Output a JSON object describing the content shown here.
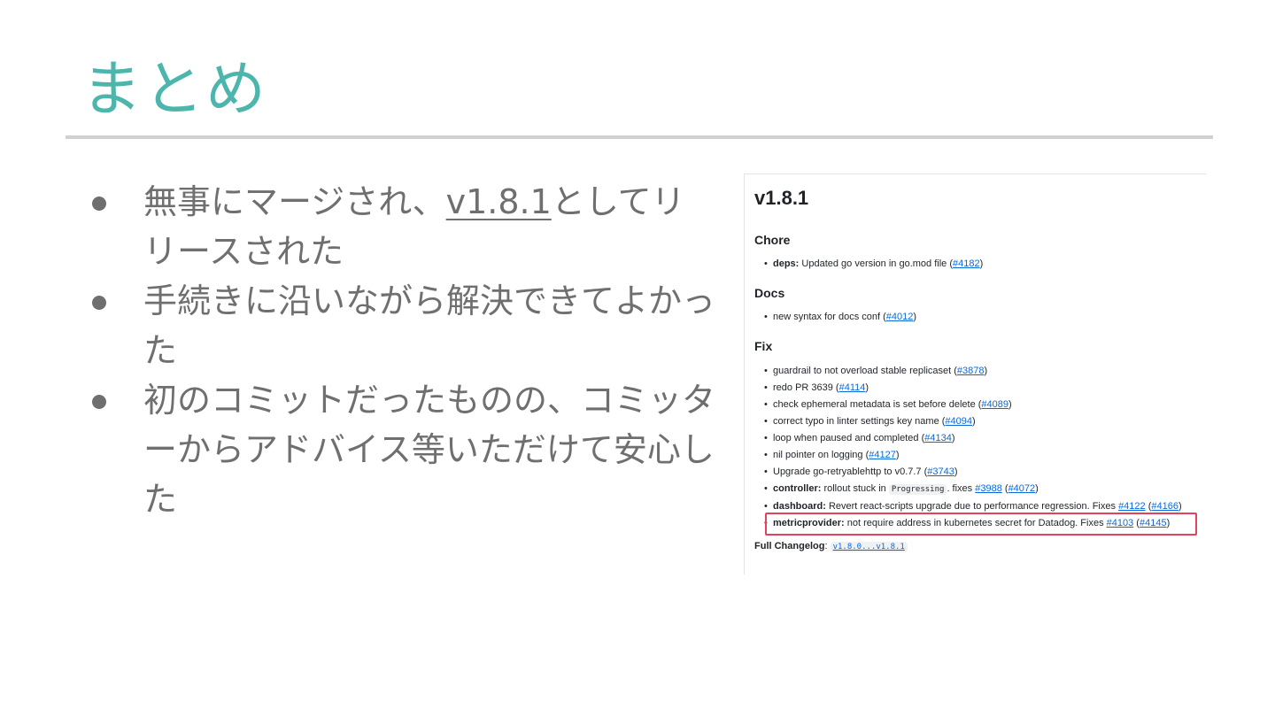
{
  "slide": {
    "title": "まとめ",
    "bullets": [
      {
        "pre": "無事にマージされ、",
        "link": "v1.8.1",
        "post": "としてリリースされた"
      },
      {
        "text": "手続きに沿いながら解決できてよかった"
      },
      {
        "text": "初のコミットだったものの、コミッターからアドバイス等いただけて安心した"
      }
    ]
  },
  "release": {
    "version": "v1.8.1",
    "sections": {
      "chore": {
        "heading": "Chore",
        "items": [
          {
            "bold": "deps:",
            "text": " Updated go version in go.mod file (",
            "link": "#4182",
            "tail": ")"
          }
        ]
      },
      "docs": {
        "heading": "Docs",
        "items": [
          {
            "text": "new syntax for docs conf (",
            "link": "#4012",
            "tail": ")"
          }
        ]
      },
      "fix": {
        "heading": "Fix",
        "items": [
          {
            "text": "guardrail to not overload stable replicaset (",
            "link": "#3878",
            "tail": ")"
          },
          {
            "text": "redo PR 3639 (",
            "link": "#4114",
            "tail": ")"
          },
          {
            "text": "check ephemeral metadata is set before delete (",
            "link": "#4089",
            "tail": ")"
          },
          {
            "text": "correct typo in linter settings key name (",
            "link": "#4094",
            "tail": ")"
          },
          {
            "text": "loop when paused and completed (",
            "link": "#4134",
            "tail": ")"
          },
          {
            "text": "nil pointer on logging (",
            "link": "#4127",
            "tail": ")"
          },
          {
            "text": "Upgrade go-retryablehttp to v0.7.7 (",
            "link": "#3743",
            "tail": ")"
          },
          {
            "bold": "controller:",
            "text": " rollout stuck in ",
            "code": "Progressing",
            "text2": ". fixes ",
            "link": "#3988",
            "mid": " (",
            "link2": "#4072",
            "tail": ")"
          },
          {
            "bold": "dashboard:",
            "text": " Revert react-scripts upgrade due to performance regression. Fixes ",
            "link": "#4122",
            "mid": " (",
            "link2": "#4166",
            "tail": ")"
          },
          {
            "bold": "metricprovider:",
            "text": " not require address in kubernetes secret for Datadog. Fixes ",
            "link": "#4103",
            "mid": " (",
            "link2": "#4145",
            "tail": ")"
          }
        ]
      }
    },
    "full_changelog_label": "Full Changelog",
    "full_changelog_sep": ": ",
    "full_changelog_link": "v1.8.0...v1.8.1"
  },
  "colors": {
    "title": "#4db6ac",
    "highlight_box": "#e0435b",
    "link": "#0969da"
  }
}
